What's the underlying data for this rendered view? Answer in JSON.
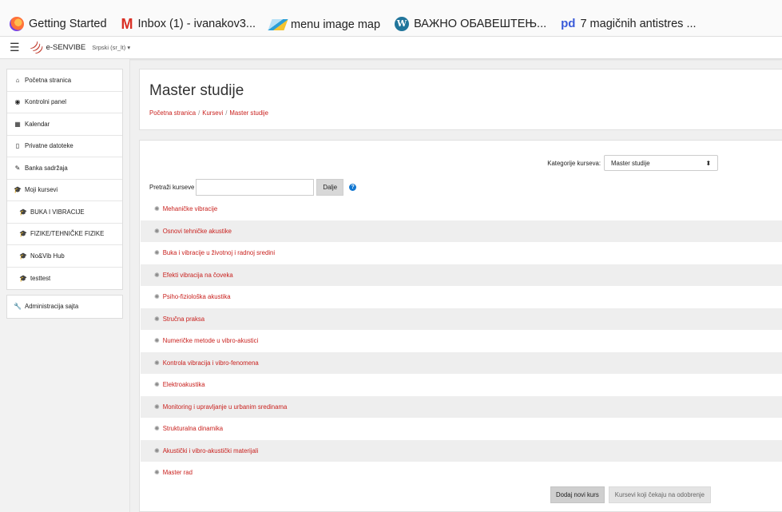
{
  "bookmarks": [
    {
      "label": "Getting Started",
      "icon": "firefox-icon"
    },
    {
      "label": "Inbox (1) - ivanakov3...",
      "icon": "gmail-icon",
      "glyph": "M"
    },
    {
      "label": "menu image map",
      "icon": "map-icon"
    },
    {
      "label": "ВАЖНО ОБАВЕШТЕЊ...",
      "icon": "wordpress-icon",
      "glyph": "W"
    },
    {
      "label": "7 magičnih antistres ...",
      "icon": "pd-icon",
      "glyph": "pd"
    }
  ],
  "navbar": {
    "menu_icon": "☰",
    "brand": "e-SENVIBE",
    "language": "Srpski (sr_lt) ▾"
  },
  "drawer": {
    "group1": [
      {
        "label": "Početna stranica",
        "icon": "home-icon",
        "glyph": "⌂"
      },
      {
        "label": "Kontrolni panel",
        "icon": "dashboard-icon",
        "glyph": "◉"
      },
      {
        "label": "Kalendar",
        "icon": "calendar-icon",
        "glyph": "▦"
      },
      {
        "label": "Privatne datoteke",
        "icon": "file-icon",
        "glyph": "▯"
      },
      {
        "label": "Banka sadržaja",
        "icon": "pencil-icon",
        "glyph": "✎"
      }
    ],
    "group2": [
      {
        "label": "Moji kursevi",
        "icon": "graduation-cap-icon",
        "glyph": "🎓"
      },
      {
        "label": "BUKA I VIBRACIJE",
        "icon": "graduation-cap-icon",
        "glyph": "🎓"
      },
      {
        "label": "FIZIKE/TEHNIČKE FIZIKE",
        "icon": "graduation-cap-icon",
        "glyph": "🎓"
      },
      {
        "label": "No&Vib Hub",
        "icon": "graduation-cap-icon",
        "glyph": "🎓"
      },
      {
        "label": "testtest",
        "icon": "graduation-cap-icon",
        "glyph": "🎓"
      }
    ],
    "admin": {
      "label": "Administracija sajta",
      "icon": "wrench-icon",
      "glyph": "🔧"
    }
  },
  "header": {
    "title": "Master studije",
    "breadcrumb": [
      "Početna stranica",
      "Kursevi",
      "Master studije"
    ],
    "separator": "/"
  },
  "main": {
    "category_label": "Kategorije kurseva:",
    "category_value": "Master studije",
    "category_arrow": "⬍",
    "search_label": "Pretraži kurseve",
    "search_value": "",
    "search_button": "Dalje",
    "help_glyph": "?",
    "course_icon": "✺",
    "courses": [
      "Mehaničke vibracije",
      "Osnovi tehničke akustike",
      "Buka i vibracije u životnoj i radnoj sredini",
      "Efekti vibracija na čoveka",
      "Psiho-fiziološka akustika",
      "Stručna praksa",
      "Numeričke metode u vibro-akustici",
      "Kontrola vibracija i vibro-fenomena",
      "Elektroakustika",
      "Monitoring i upravljanje u urbanim sredinama",
      "Strukturalna dinamika",
      "Akustički i vibro-akustički materijali",
      "Master rad"
    ],
    "add_button": "Dodaj novi kurs",
    "pending_button": "Kursevi koji čekaju na odobrenje"
  },
  "colors": {
    "link": "#c9211e",
    "help": "#1177d1"
  }
}
